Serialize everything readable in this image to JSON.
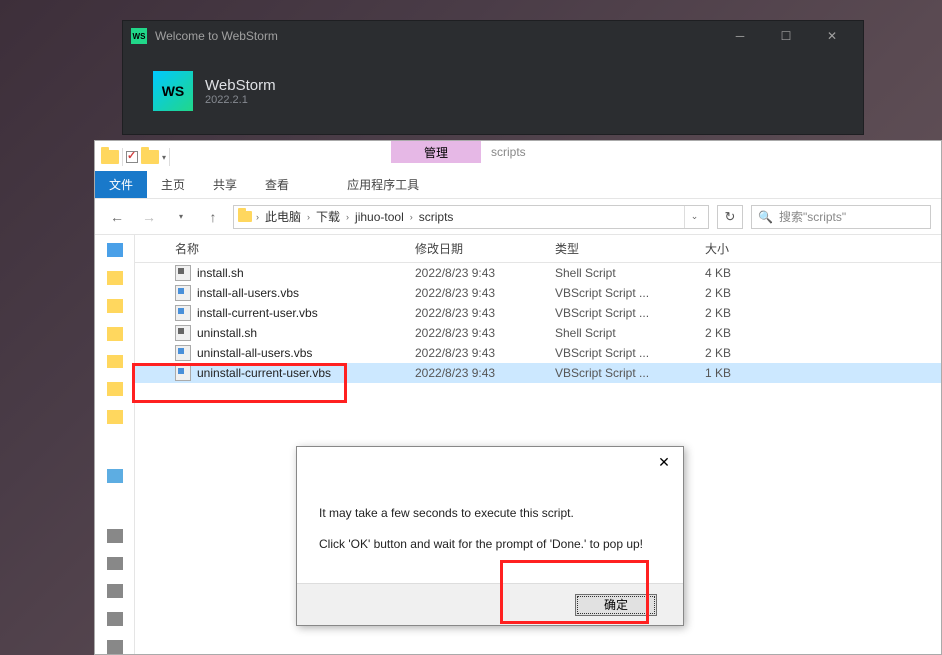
{
  "webstorm": {
    "title": "Welcome to WebStorm",
    "icon_label": "WS",
    "name": "WebStorm",
    "version": "2022.2.1"
  },
  "explorer": {
    "tab_manage": "管理",
    "tab_scripts": "scripts",
    "ribbon": {
      "file": "文件",
      "home": "主页",
      "share": "共享",
      "view": "查看",
      "apptools": "应用程序工具"
    },
    "breadcrumb": {
      "seg1": "此电脑",
      "seg2": "下载",
      "seg3": "jihuo-tool",
      "seg4": "scripts"
    },
    "search_placeholder": "搜索\"scripts\"",
    "columns": {
      "name": "名称",
      "date": "修改日期",
      "type": "类型",
      "size": "大小"
    },
    "files": [
      {
        "name": "install.sh",
        "date": "2022/8/23 9:43",
        "type": "Shell Script",
        "size": "4 KB",
        "kind": "sh"
      },
      {
        "name": "install-all-users.vbs",
        "date": "2022/8/23 9:43",
        "type": "VBScript Script ...",
        "size": "2 KB",
        "kind": "vbs"
      },
      {
        "name": "install-current-user.vbs",
        "date": "2022/8/23 9:43",
        "type": "VBScript Script ...",
        "size": "2 KB",
        "kind": "vbs"
      },
      {
        "name": "uninstall.sh",
        "date": "2022/8/23 9:43",
        "type": "Shell Script",
        "size": "2 KB",
        "kind": "sh"
      },
      {
        "name": "uninstall-all-users.vbs",
        "date": "2022/8/23 9:43",
        "type": "VBScript Script ...",
        "size": "2 KB",
        "kind": "vbs"
      },
      {
        "name": "uninstall-current-user.vbs",
        "date": "2022/8/23 9:43",
        "type": "VBScript Script ...",
        "size": "1 KB",
        "kind": "vbs",
        "selected": true
      }
    ]
  },
  "dialog": {
    "line1": "It may take a few seconds to execute this script.",
    "line2": "Click 'OK' button and wait for the prompt of 'Done.' to pop up!",
    "ok": "确定"
  }
}
